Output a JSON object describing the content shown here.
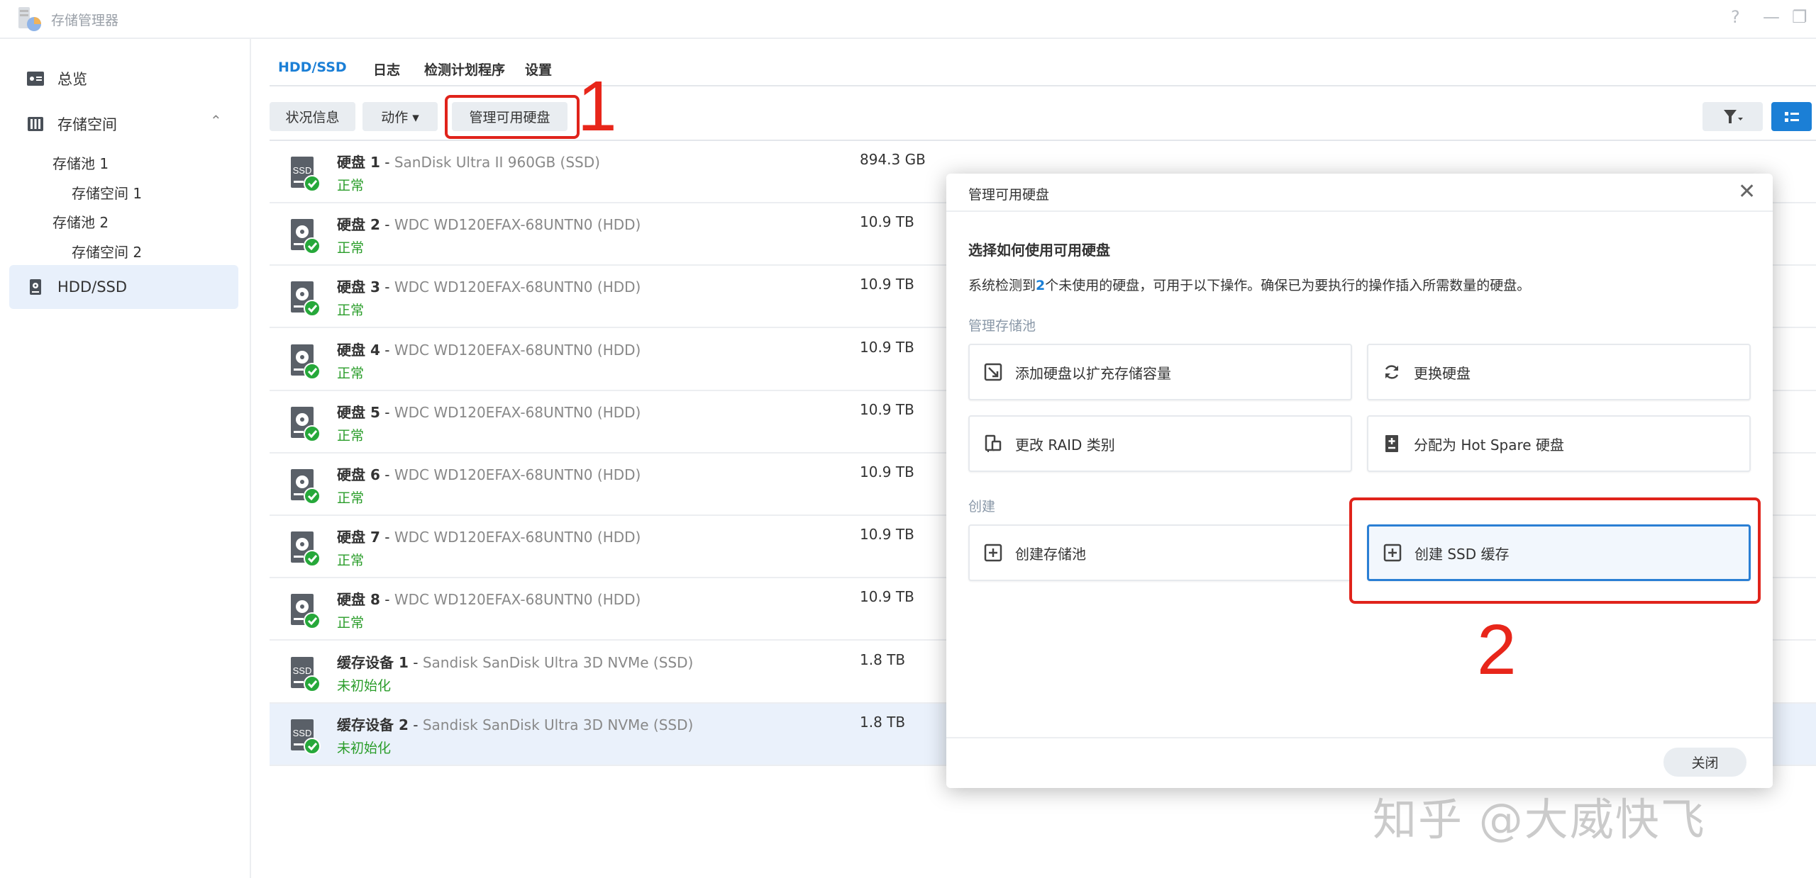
{
  "window": {
    "title": "存储管理器",
    "controls": [
      "?",
      "—",
      "❐"
    ]
  },
  "sidebar": {
    "overview": "总览",
    "storage": "存储空间",
    "pool1": "存储池 1",
    "volume1": "存储空间 1",
    "pool2": "存储池 2",
    "volume2": "存储空间 2",
    "hdd": "HDD/SSD"
  },
  "tabs": [
    "HDD/SSD",
    "日志",
    "检测计划程序",
    "设置"
  ],
  "toolbar": {
    "status": "状况信息",
    "action": "动作 ▾",
    "manage": "管理可用硬盘"
  },
  "annotations": {
    "step1": "1",
    "step2": "2"
  },
  "disks": [
    {
      "label": "硬盘 1",
      "model": "SanDisk Ultra II 960GB (SSD)",
      "status": "正常",
      "size": "894.3 GB",
      "type": "ssd"
    },
    {
      "label": "硬盘 2",
      "model": "WDC WD120EFAX-68UNTN0 (HDD)",
      "status": "正常",
      "size": "10.9 TB",
      "type": "hdd"
    },
    {
      "label": "硬盘 3",
      "model": "WDC WD120EFAX-68UNTN0 (HDD)",
      "status": "正常",
      "size": "10.9 TB",
      "type": "hdd"
    },
    {
      "label": "硬盘 4",
      "model": "WDC WD120EFAX-68UNTN0 (HDD)",
      "status": "正常",
      "size": "10.9 TB",
      "type": "hdd"
    },
    {
      "label": "硬盘 5",
      "model": "WDC WD120EFAX-68UNTN0 (HDD)",
      "status": "正常",
      "size": "10.9 TB",
      "type": "hdd"
    },
    {
      "label": "硬盘 6",
      "model": "WDC WD120EFAX-68UNTN0 (HDD)",
      "status": "正常",
      "size": "10.9 TB",
      "type": "hdd"
    },
    {
      "label": "硬盘 7",
      "model": "WDC WD120EFAX-68UNTN0 (HDD)",
      "status": "正常",
      "size": "10.9 TB",
      "type": "hdd"
    },
    {
      "label": "硬盘 8",
      "model": "WDC WD120EFAX-68UNTN0 (HDD)",
      "status": "正常",
      "size": "10.9 TB",
      "type": "hdd"
    },
    {
      "label": "缓存设备 1",
      "model": "Sandisk SanDisk Ultra 3D NVMe (SSD)",
      "status": "未初始化",
      "size": "1.8 TB",
      "type": "ssd"
    },
    {
      "label": "缓存设备 2",
      "model": "Sandisk SanDisk Ultra 3D NVMe (SSD)",
      "status": "未初始化",
      "size": "1.8 TB",
      "type": "ssd",
      "selected": true
    }
  ],
  "dialog": {
    "title": "管理可用硬盘",
    "heading": "选择如何使用可用硬盘",
    "desc_pre": "系统检测到",
    "desc_count": "2",
    "desc_post": "个未使用的硬盘，可用于以下操作。确保已为要执行的操作插入所需数量的硬盘。",
    "section_manage": "管理存储池",
    "add_disk": "添加硬盘以扩充存储容量",
    "replace_disk": "更换硬盘",
    "change_raid": "更改 RAID 类别",
    "hot_spare": "分配为 Hot Spare 硬盘",
    "section_create": "创建",
    "create_pool": "创建存储池",
    "create_cache": "创建 SSD 缓存",
    "close": "关闭"
  },
  "watermark": "知乎 @大威快飞",
  "colors": {
    "accent": "#1b7fd6",
    "ok": "#2a9d2a",
    "annotation": "#e0231b"
  }
}
